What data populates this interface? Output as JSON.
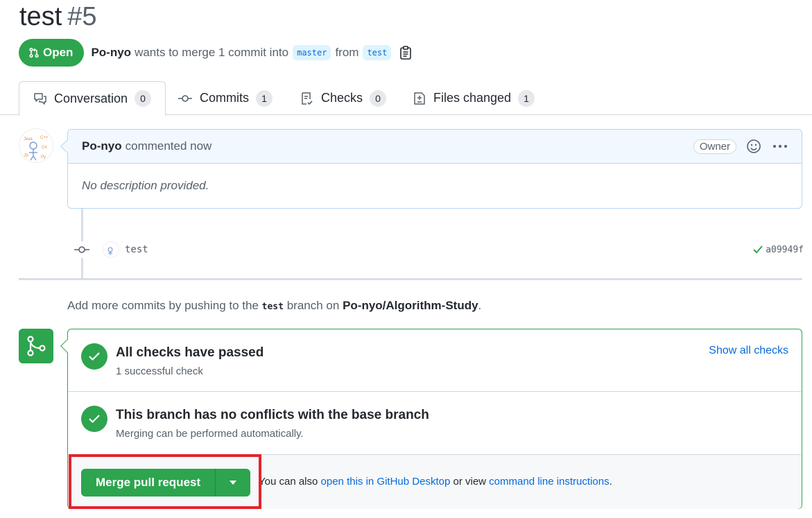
{
  "pr": {
    "title": "test",
    "number": "#5",
    "state": "Open",
    "author": "Po-nyo",
    "merge_text": "wants to merge 1 commit into",
    "base_branch": "master",
    "from_text": "from",
    "head_branch": "test"
  },
  "tabs": [
    {
      "label": "Conversation",
      "count": "0"
    },
    {
      "label": "Commits",
      "count": "1"
    },
    {
      "label": "Checks",
      "count": "0"
    },
    {
      "label": "Files changed",
      "count": "1"
    }
  ],
  "comment": {
    "author": "Po-nyo",
    "action": "commented now",
    "role": "Owner",
    "body": "No description provided."
  },
  "commit": {
    "message": "test",
    "sha": "a09949f"
  },
  "hint": {
    "prefix": "Add more commits by pushing to the",
    "branch": "test",
    "middle": "branch on",
    "repo": "Po-nyo/Algorithm-Study",
    "suffix": "."
  },
  "merge": {
    "checks_title": "All checks have passed",
    "checks_sub": "1 successful check",
    "show_checks": "Show all checks",
    "conflicts_title": "This branch has no conflicts with the base branch",
    "conflicts_sub": "Merging can be performed automatically.",
    "button": "Merge pull request",
    "footer_prefix": "You can also",
    "footer_link1": "open this in GitHub Desktop",
    "footer_mid": "or view",
    "footer_link2": "command line instructions",
    "footer_suffix": "."
  },
  "colors": {
    "success": "#2da44e",
    "link": "#0969da",
    "highlight": "#e3242b"
  }
}
